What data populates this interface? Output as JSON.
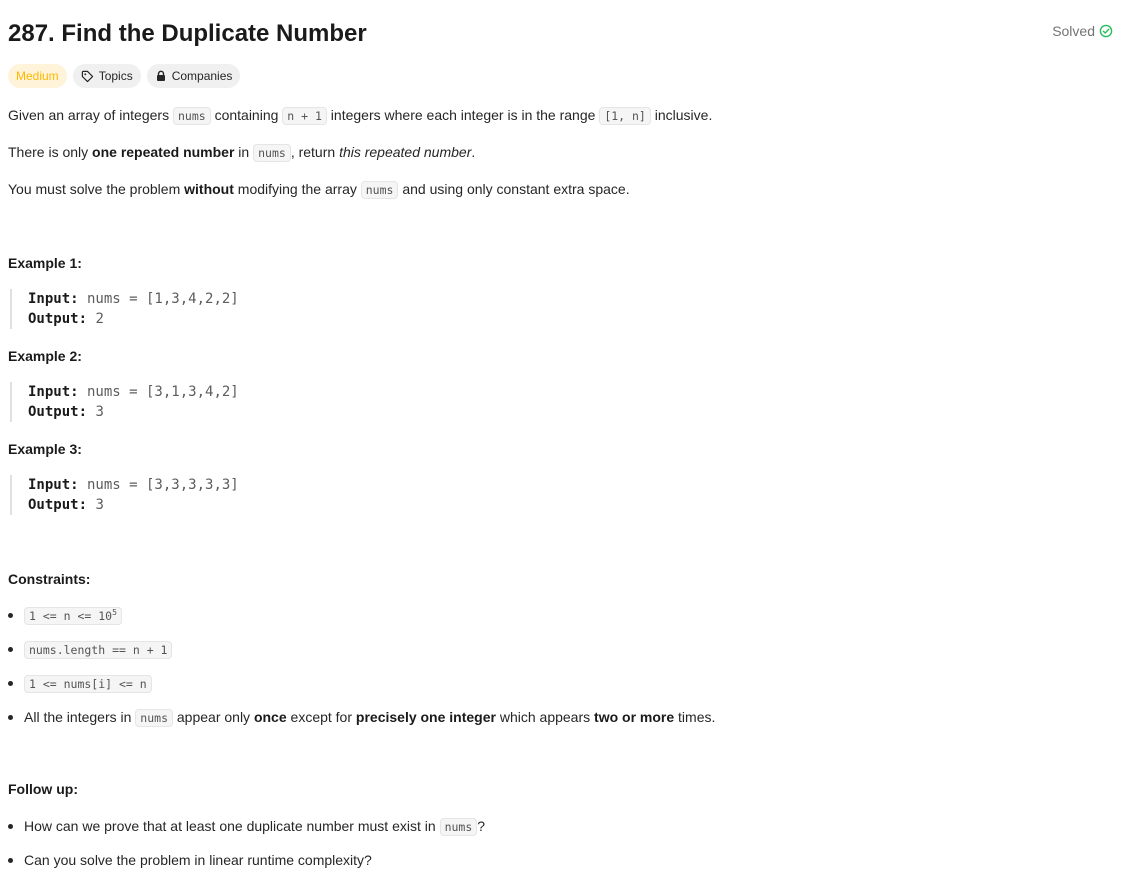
{
  "problem": {
    "title": "287. Find the Duplicate Number",
    "status": "Solved"
  },
  "tags": {
    "difficulty": "Medium",
    "topics": "Topics",
    "companies": "Companies"
  },
  "description": {
    "p1": {
      "t1": "Given an array of integers ",
      "c1": "nums",
      "t2": " containing ",
      "c2": "n + 1",
      "t3": " integers where each integer is in the range ",
      "c3": "[1, n]",
      "t4": " inclusive."
    },
    "p2": {
      "t1": "There is only ",
      "b1": "one repeated number",
      "t2": " in ",
      "c1": "nums",
      "t3": ", return ",
      "i1": "this repeated number",
      "t4": "."
    },
    "p3": {
      "t1": "You must solve the problem ",
      "b1": "without",
      "t2": " modifying the array ",
      "c1": "nums",
      "t3": " and using only constant extra space."
    }
  },
  "examples": [
    {
      "heading": "Example 1:",
      "input_label": "Input:",
      "input": " nums = [1,3,4,2,2]",
      "output_label": "Output:",
      "output": " 2"
    },
    {
      "heading": "Example 2:",
      "input_label": "Input:",
      "input": " nums = [3,1,3,4,2]",
      "output_label": "Output:",
      "output": " 3"
    },
    {
      "heading": "Example 3:",
      "input_label": "Input:",
      "input": " nums = [3,3,3,3,3]",
      "output_label": "Output:",
      "output": " 3"
    }
  ],
  "constraints": {
    "heading": "Constraints:",
    "c1_base": "1 <= n <= 10",
    "c1_exp": "5",
    "c2": "nums.length == n + 1",
    "c3": "1 <= nums[i] <= n",
    "c4": {
      "t1": "All the integers in ",
      "c1": "nums",
      "t2": " appear only ",
      "b1": "once",
      "t3": " except for ",
      "b2": "precisely one integer",
      "t4": " which appears ",
      "b3": "two or more",
      "t5": " times."
    }
  },
  "follow_up": {
    "heading": "Follow up:",
    "f1": {
      "t1": "How can we prove that at least one duplicate number must exist in ",
      "c1": "nums",
      "t2": "?"
    },
    "f2": "Can you solve the problem in linear runtime complexity?"
  },
  "colors": {
    "medium_text": "#ffb800",
    "medium_bg": "#fff3da",
    "solved_icon": "#2cbb5d"
  }
}
